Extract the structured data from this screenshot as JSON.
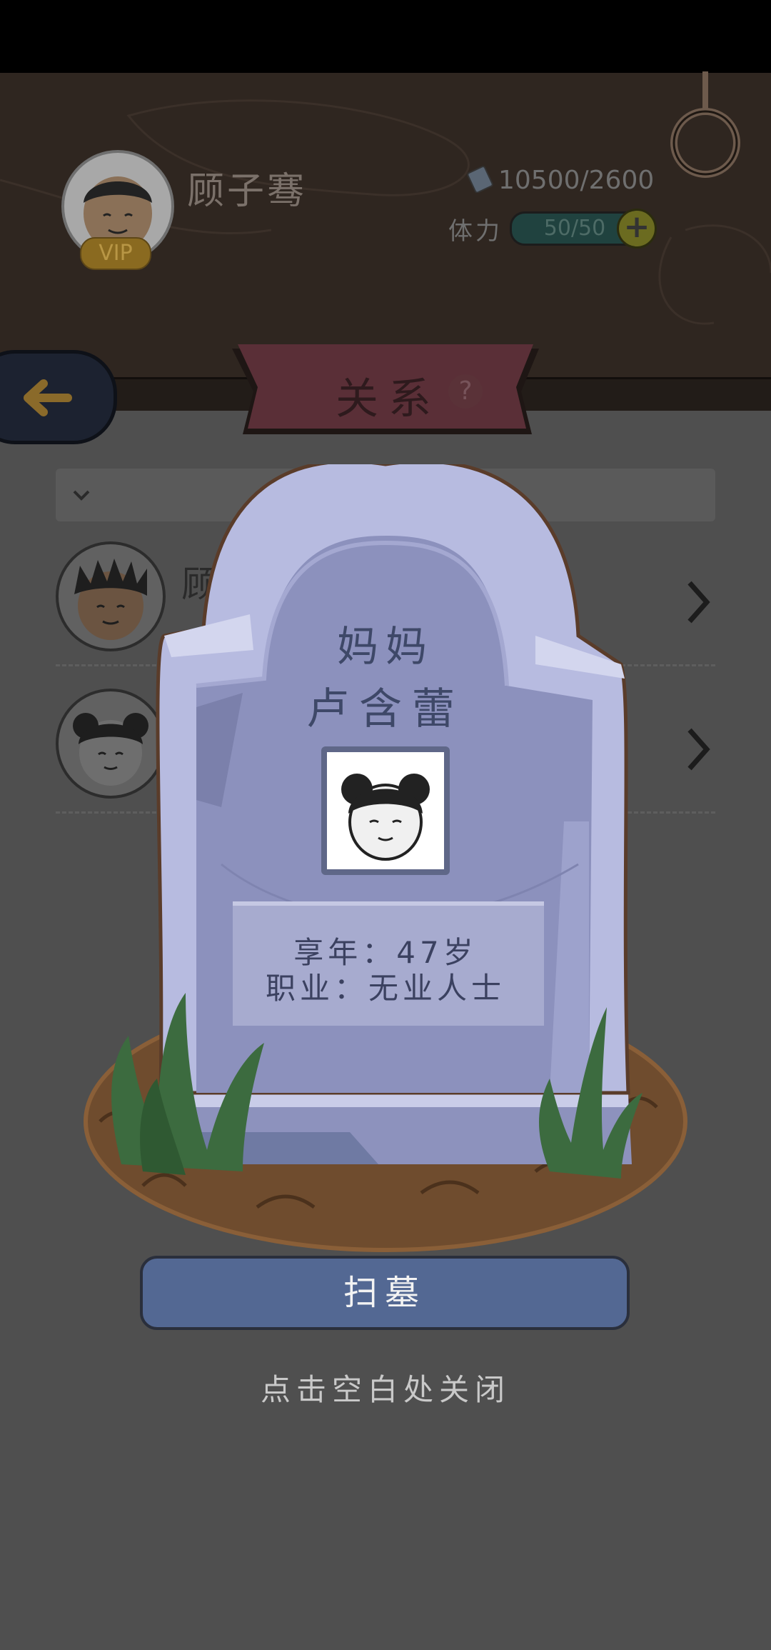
{
  "player": {
    "name": "顾子骞",
    "vip_label": "VIP",
    "money": "10500/2600"
  },
  "stamina": {
    "label": "体力",
    "value": "50/50"
  },
  "header": {
    "title": "关系",
    "help": "?"
  },
  "relations": [
    {
      "name": "顾明"
    },
    {
      "name": ""
    }
  ],
  "tombstone": {
    "relation": "妈妈",
    "name": "卢含蕾",
    "age_line": "享年：47岁",
    "job_line": "职业：无业人士"
  },
  "actions": {
    "sweep_label": "扫墓",
    "close_hint": "点击空白处关闭"
  },
  "colors": {
    "overlay": "#4f4f4f",
    "button": "#536893",
    "stone": "#b7bbe0",
    "banner": "#5a2f37"
  }
}
